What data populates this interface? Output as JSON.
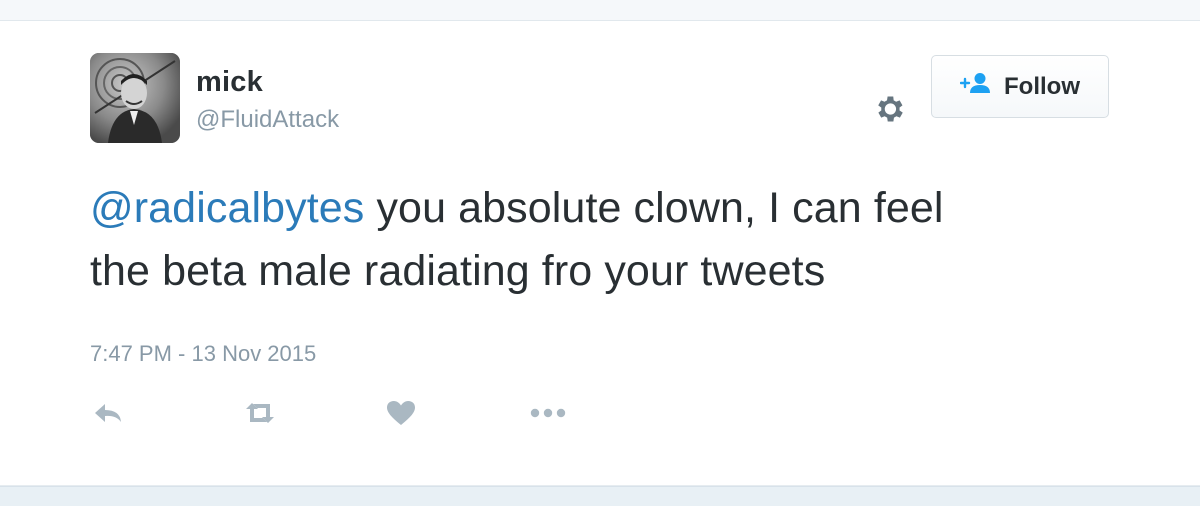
{
  "user": {
    "name": "mick",
    "handle": "@FluidAttack"
  },
  "header": {
    "follow_label": "Follow",
    "settings_icon": "gear-icon",
    "follow_icon": "add-user-icon"
  },
  "tweet": {
    "mention": "@radicalbytes",
    "text_line1": " you absolute clown, I can feel",
    "text_line2": "the beta male radiating fro your tweets",
    "timestamp": "7:47 PM - 13 Nov 2015"
  },
  "actions": {
    "icons": [
      "reply-icon",
      "retweet-icon",
      "like-icon",
      "more-icon"
    ]
  },
  "colors": {
    "text": "#292f33",
    "muted": "#8899a6",
    "mention": "#2b7bb9",
    "follow_accent": "#1da1f2",
    "icon": "#aab8c2",
    "gear": "#66757f"
  }
}
